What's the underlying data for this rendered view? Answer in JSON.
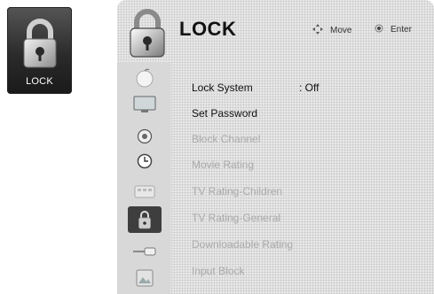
{
  "tile": {
    "label": "LOCK",
    "icon": "padlock-icon"
  },
  "header": {
    "title": "LOCK",
    "hint_move": "Move",
    "hint_enter": "Enter"
  },
  "categories": [
    {
      "icon": "apple-icon"
    },
    {
      "icon": "picture-icon"
    },
    {
      "icon": "audio-icon"
    },
    {
      "icon": "clock-icon"
    },
    {
      "icon": "option-icon"
    },
    {
      "icon": "padlock-icon",
      "active": true
    },
    {
      "icon": "input-icon"
    },
    {
      "icon": "photo-icon"
    }
  ],
  "items": [
    {
      "label": "Lock System",
      "value": ": Off",
      "enabled": true
    },
    {
      "label": "Set Password",
      "enabled": true
    },
    {
      "label": "Block Channel",
      "enabled": false
    },
    {
      "label": "Movie Rating",
      "enabled": false
    },
    {
      "label": "TV Rating-Children",
      "enabled": false
    },
    {
      "label": "TV Rating-General",
      "enabled": false
    },
    {
      "label": "Downloadable Rating",
      "enabled": false
    },
    {
      "label": "Input Block",
      "enabled": false
    }
  ]
}
